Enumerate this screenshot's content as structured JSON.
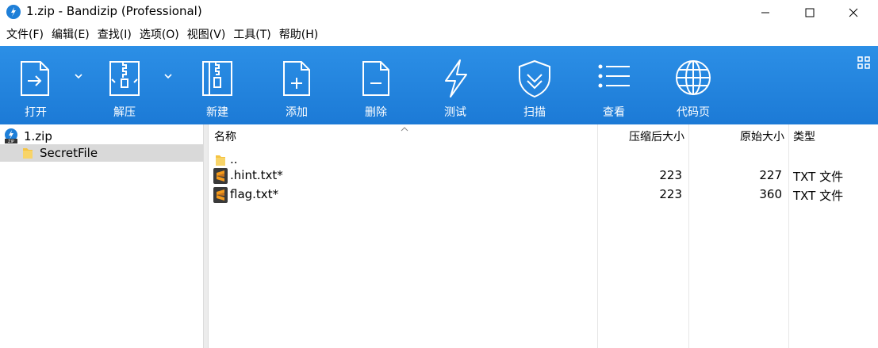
{
  "window": {
    "title": "1.zip - Bandizip (Professional)"
  },
  "menu": [
    {
      "label": "文件(F)"
    },
    {
      "label": "编辑(E)"
    },
    {
      "label": "查找(I)"
    },
    {
      "label": "选项(O)"
    },
    {
      "label": "视图(V)"
    },
    {
      "label": "工具(T)"
    },
    {
      "label": "帮助(H)"
    }
  ],
  "toolbar": {
    "open": "打开",
    "extract": "解压",
    "new": "新建",
    "add": "添加",
    "delete": "删除",
    "test": "测试",
    "scan": "扫描",
    "view": "查看",
    "codepage": "代码页"
  },
  "tree": {
    "root": "1.zip",
    "child": "SecretFile"
  },
  "columns": {
    "name": "名称",
    "compressed": "压缩后大小",
    "original": "原始大小",
    "type": "类型"
  },
  "files": [
    {
      "name": "..",
      "compressed": "",
      "original": "",
      "type": "",
      "icon": "folder-icon"
    },
    {
      "name": ".hint.txt*",
      "compressed": "223",
      "original": "227",
      "type": "TXT 文件",
      "icon": "sublime-file-icon"
    },
    {
      "name": "flag.txt*",
      "compressed": "223",
      "original": "360",
      "type": "TXT 文件",
      "icon": "sublime-file-icon"
    }
  ],
  "colors": {
    "toolbar": "#1f80d9",
    "selection": "#d9d9d9",
    "folder": "#f5c341",
    "file_icon_bg": "#3a3a3a",
    "file_icon_accent": "#f49a1b"
  }
}
